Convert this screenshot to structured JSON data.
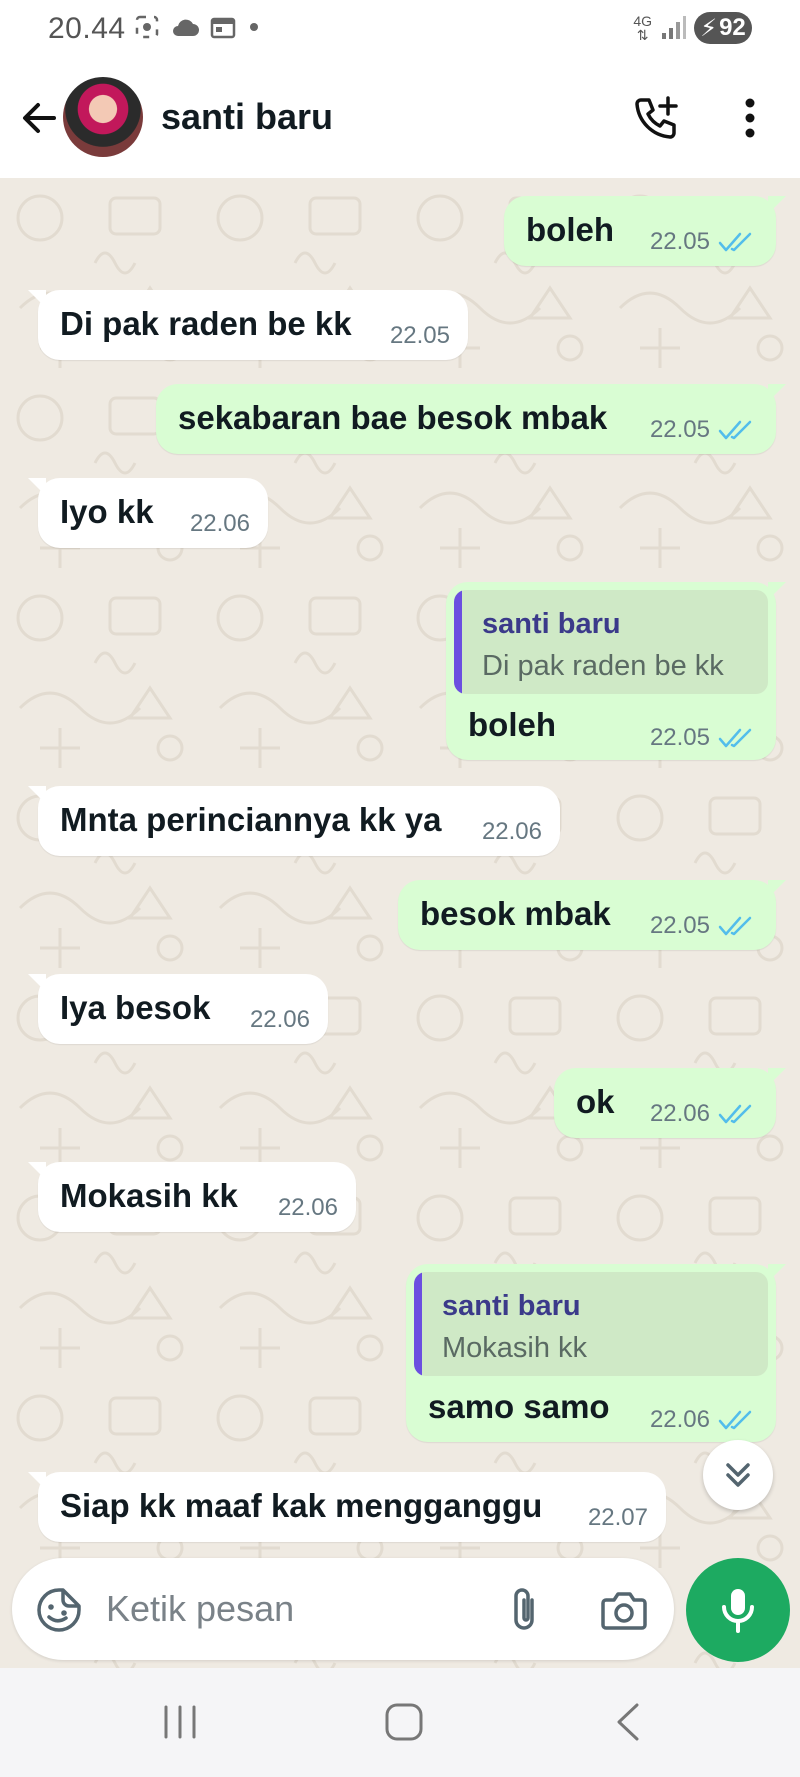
{
  "status_bar": {
    "time": "20.44",
    "network": "4G",
    "battery": "92"
  },
  "header": {
    "contact_name": "santi baru"
  },
  "messages": [
    {
      "dir": "out",
      "text": "boleh",
      "time": "22.05",
      "read": true
    },
    {
      "dir": "in",
      "text": "Di pak raden be kk",
      "time": "22.05"
    },
    {
      "dir": "out",
      "text": "sekabaran bae besok mbak",
      "time": "22.05",
      "read": true
    },
    {
      "dir": "in",
      "text": "Iyo kk",
      "time": "22.06"
    },
    {
      "dir": "out",
      "text": "boleh",
      "time": "22.05",
      "read": true,
      "quote": {
        "author": "santi baru",
        "text": "Di pak raden be kk"
      }
    },
    {
      "dir": "in",
      "text": "Mnta perinciannya kk ya",
      "time": "22.06"
    },
    {
      "dir": "out",
      "text": "besok mbak",
      "time": "22.05",
      "read": true
    },
    {
      "dir": "in",
      "text": "Iya besok",
      "time": "22.06"
    },
    {
      "dir": "out",
      "text": "ok",
      "time": "22.06",
      "read": true
    },
    {
      "dir": "in",
      "text": "Mokasih kk",
      "time": "22.06"
    },
    {
      "dir": "out",
      "text": "samo samo",
      "time": "22.06",
      "read": true,
      "quote": {
        "author": "santi baru",
        "text": "Mokasih kk"
      }
    },
    {
      "dir": "in",
      "text": "Siap kk maaf kak mengganggu",
      "time": "22.07"
    }
  ],
  "composer": {
    "placeholder": "Ketik pesan"
  },
  "colors": {
    "incoming_bubble": "#ffffff",
    "outgoing_bubble": "#d9fdd3",
    "read_ticks": "#53bdeb",
    "mic_button": "#1daa61",
    "chat_background": "#efeae2"
  },
  "icons": [
    "back-arrow-icon",
    "add-call-icon",
    "more-vertical-icon",
    "double-check-icon",
    "double-chevron-down-icon",
    "sticker-icon",
    "paperclip-icon",
    "camera-icon",
    "mic-icon",
    "recents-icon",
    "home-icon",
    "nav-back-icon"
  ]
}
